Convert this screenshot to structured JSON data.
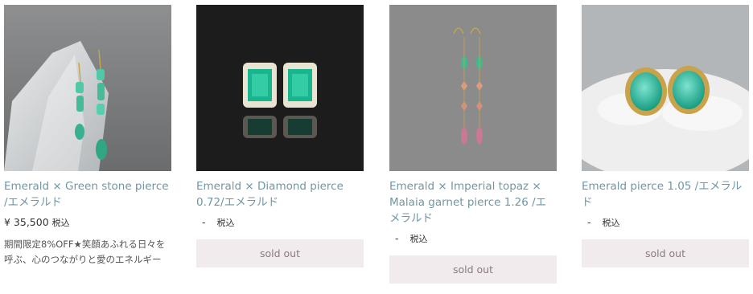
{
  "products": [
    {
      "title": "Emerald × Green stone pierce /エメラルド",
      "price": "¥ 35,500",
      "tax": "税込",
      "description": "期間限定8%OFF★笑顔あふれる日々を呼ぶ、心のつながりと愛のエネルギー"
    },
    {
      "title": "Emerald × Diamond pierce 0.72/エメラルド",
      "price": "-",
      "tax": "税込",
      "button": "sold out"
    },
    {
      "title": "Emerald × Imperial topaz × Malaia garnet pierce 1.26 /エメラルド",
      "price": "-",
      "tax": "税込",
      "button": "sold out"
    },
    {
      "title": "Emerald pierce 1.05 /エメラルド",
      "price": "-",
      "tax": "税込",
      "button": "sold out"
    }
  ],
  "colors": {
    "title_link": "#6f97a4",
    "soldout_bg": "#f2ebee",
    "soldout_text": "#8a7a80"
  },
  "image_icons": [
    "green-stone-earrings-image",
    "diamond-emerald-earrings-image",
    "topaz-garnet-earrings-image",
    "emerald-studs-image"
  ]
}
